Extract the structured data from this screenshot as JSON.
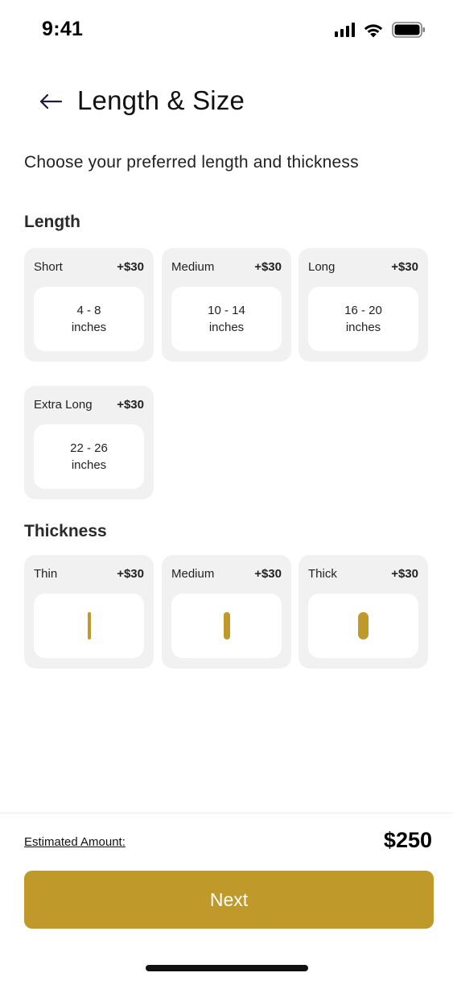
{
  "status_bar": {
    "time": "9:41",
    "icons": [
      "signal-icon",
      "wifi-icon",
      "battery-icon"
    ]
  },
  "header": {
    "back_icon": "arrow-left-icon",
    "title": "Length & Size"
  },
  "subtitle": "Choose your preferred length and thickness",
  "length": {
    "title": "Length",
    "options": [
      {
        "name": "Short",
        "price": "+$30",
        "range": "4 - 8",
        "unit": "inches"
      },
      {
        "name": "Medium",
        "price": "+$30",
        "range": "10 - 14",
        "unit": "inches"
      },
      {
        "name": "Long",
        "price": "+$30",
        "range": "16 - 20",
        "unit": "inches"
      },
      {
        "name": "Extra Long",
        "price": "+$30",
        "range": "22 - 26",
        "unit": "inches"
      }
    ]
  },
  "thickness": {
    "title": "Thickness",
    "options": [
      {
        "name": "Thin",
        "price": "+$30"
      },
      {
        "name": "Medium",
        "price": "+$30"
      },
      {
        "name": "Thick",
        "price": "+$30"
      }
    ]
  },
  "footer": {
    "estimated_label": "Estimated Amount:",
    "estimated_value": "$250",
    "next_label": "Next"
  },
  "colors": {
    "accent": "#bf9a2b",
    "card_bg": "#f1f1f1"
  }
}
